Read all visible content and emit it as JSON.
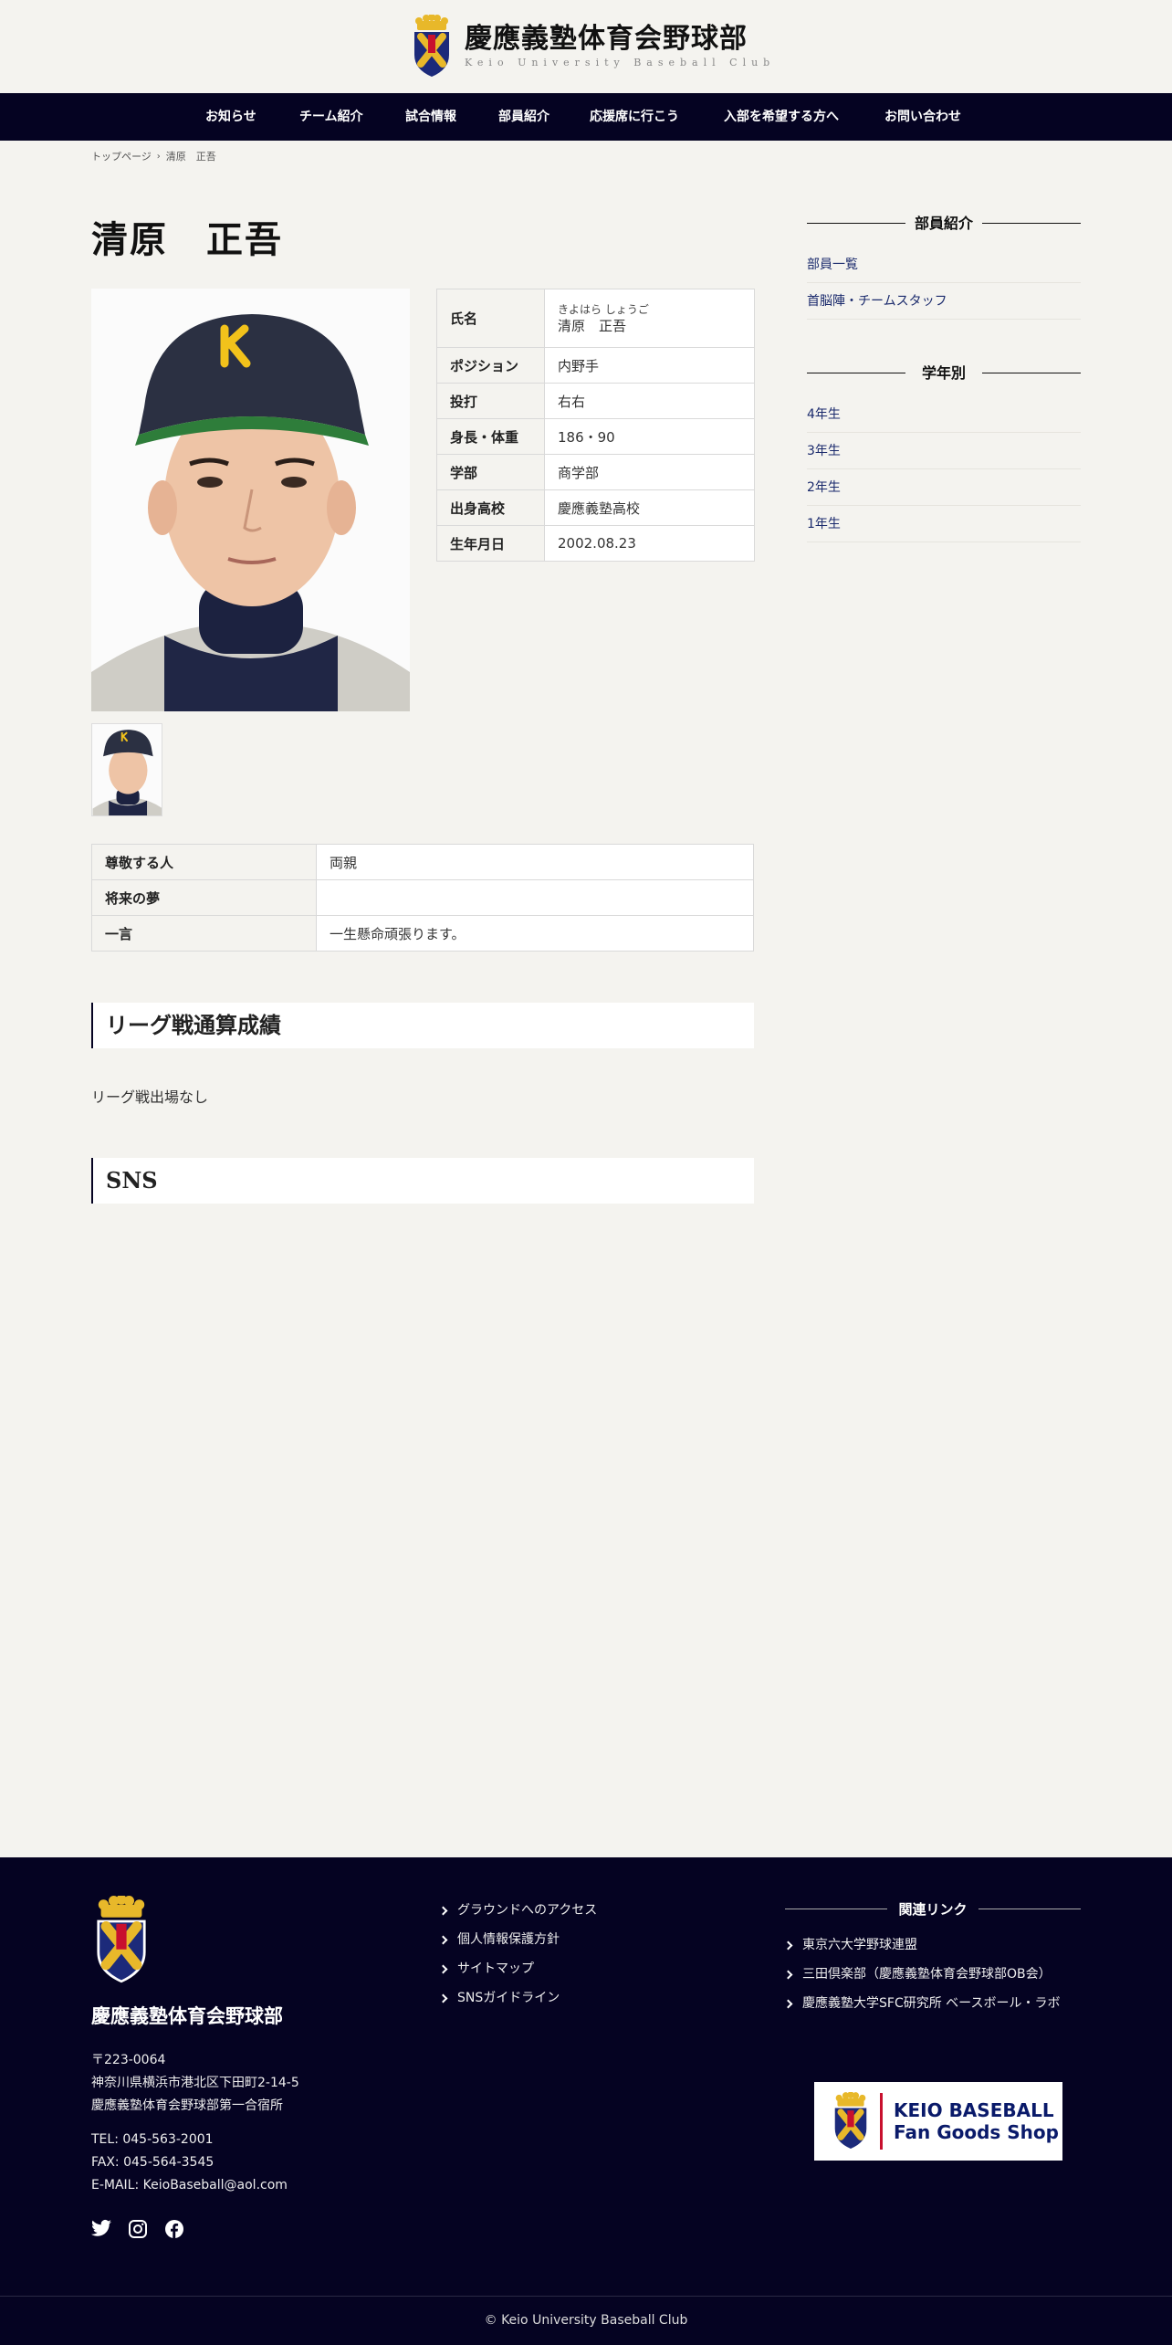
{
  "header": {
    "title_jp": "慶應義塾体育会野球部",
    "title_en": "Keio University Baseball Club"
  },
  "nav": [
    {
      "label": "お知らせ"
    },
    {
      "label": "チーム紹介"
    },
    {
      "label": "試合情報"
    },
    {
      "label": "部員紹介"
    },
    {
      "label": "応援席に行こう"
    },
    {
      "label": "入部を希望する方へ"
    },
    {
      "label": "お問い合わせ"
    }
  ],
  "breadcrumb": {
    "home": "トップページ",
    "current": "清原　正吾"
  },
  "player": {
    "name": "清原　正吾",
    "profile": [
      {
        "label": "氏名",
        "kana": "きよはら しょうご",
        "value": "清原　正吾"
      },
      {
        "label": "ポジション",
        "value": "内野手"
      },
      {
        "label": "投打",
        "value": "右右"
      },
      {
        "label": "身長・体重",
        "value": "186・90"
      },
      {
        "label": "学部",
        "value": "商学部"
      },
      {
        "label": "出身高校",
        "value": "慶應義塾高校"
      },
      {
        "label": "生年月日",
        "value": "2002.08.23"
      }
    ],
    "extra": [
      {
        "label": "尊敬する人",
        "value": "両親"
      },
      {
        "label": "将来の夢",
        "value": ""
      },
      {
        "label": "一言",
        "value": "一生懸命頑張ります。"
      }
    ],
    "cap_letter": "K"
  },
  "sections": {
    "league_title": "リーグ戦通算成績",
    "league_text": "リーグ戦出場なし",
    "sns_title": "SNS"
  },
  "sidebar": {
    "members_heading": "部員紹介",
    "members_links": [
      {
        "label": "部員一覧"
      },
      {
        "label": "首脳陣・チームスタッフ"
      }
    ],
    "grade_heading": "学年別",
    "grade_links": [
      {
        "label": "4年生"
      },
      {
        "label": "3年生"
      },
      {
        "label": "2年生"
      },
      {
        "label": "1年生"
      }
    ]
  },
  "footer": {
    "club_name": "慶應義塾体育会野球部",
    "postal": "〒223-0064",
    "address1": "神奈川県横浜市港北区下田町2-14-5",
    "address2": "慶應義塾体育会野球部第一合宿所",
    "tel": "TEL: 045-563-2001",
    "fax": "FAX: 045-564-3545",
    "email": "E-MAIL: KeioBaseball@aol.com",
    "links": [
      {
        "label": "グラウンドへのアクセス"
      },
      {
        "label": "個人情報保護方針"
      },
      {
        "label": "サイトマップ"
      },
      {
        "label": "SNSガイドライン"
      }
    ],
    "related_heading": "関連リンク",
    "related_links": [
      {
        "label": "東京六大学野球連盟"
      },
      {
        "label": "三田倶楽部（慶應義塾体育会野球部OB会）"
      },
      {
        "label": "慶應義塾大学SFC研究所 ベースボール・ラボ"
      }
    ],
    "banner_line1": "KEIO BASEBALL",
    "banner_line2": "Fan Goods Shop",
    "copyright": "© Keio University Baseball Club"
  },
  "colors": {
    "navy": "#050322",
    "background": "#f4f3ef",
    "link": "#1a2a6c",
    "crest_red": "#c8102e",
    "crest_gold": "#e8b82a"
  }
}
